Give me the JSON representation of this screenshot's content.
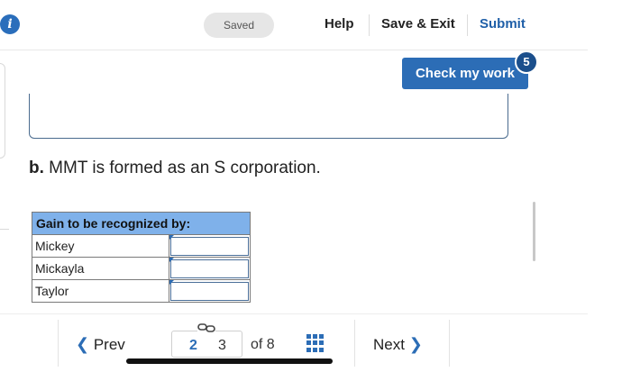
{
  "header": {
    "saved_label": "Saved",
    "help_label": "Help",
    "save_exit_label": "Save & Exit",
    "submit_label": "Submit"
  },
  "check_work": {
    "label": "Check my work",
    "badge_count": "5"
  },
  "question": {
    "part": "b.",
    "text": "MMT is formed as an S corporation."
  },
  "table": {
    "header": "Gain to be recognized by:",
    "rows": [
      {
        "label": "Mickey",
        "value": ""
      },
      {
        "label": "Mickayla",
        "value": ""
      },
      {
        "label": "Taylor",
        "value": ""
      }
    ]
  },
  "pagination": {
    "prev_label": "Prev",
    "pages": [
      "2",
      "3"
    ],
    "of_label": "of 8",
    "next_label": "Next"
  },
  "colors": {
    "accent": "#2c6db6",
    "table_header": "#7fb1ea"
  }
}
